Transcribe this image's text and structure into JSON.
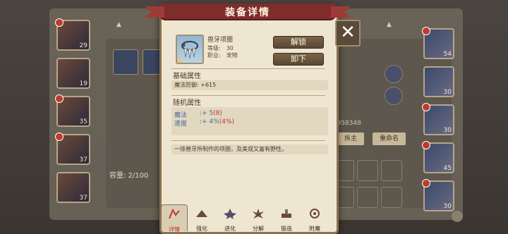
{
  "modal": {
    "title": "装备详情",
    "item_name": "兽牙项圈",
    "level_label": "等级:",
    "level_value": "30",
    "job_label": "职业:",
    "job_value": "宠物",
    "unlock_button": "解锁",
    "unequip_button": "卸下",
    "base_header": "基础属性",
    "base_stat": "魔法防御: +615",
    "random_header": "随机属性",
    "random_stats": [
      {
        "name": "魔法",
        "value": ":+ 5",
        "extra": "(8)"
      },
      {
        "name": "速度",
        "value": ":+ 4%",
        "extra": "(4%)"
      }
    ],
    "description": "一排兽牙所制作的项圈，及美观又富有野性。"
  },
  "tabs": [
    {
      "label": "详情",
      "icon": "detail-icon",
      "active": true
    },
    {
      "label": "强化",
      "icon": "enhance-icon",
      "active": false
    },
    {
      "label": "进化",
      "icon": "evolve-icon",
      "active": false
    },
    {
      "label": "分解",
      "icon": "decompose-icon",
      "active": false
    },
    {
      "label": "锻造",
      "icon": "forge-icon",
      "active": false
    },
    {
      "label": "附魔",
      "icon": "enchant-icon",
      "active": false
    }
  ],
  "background": {
    "capacity_text": "容量: 2/100",
    "left_hero_levels": [
      "29",
      "19",
      "35",
      "37",
      "37"
    ],
    "right_hero_levels": [
      "54",
      "30",
      "30",
      "45",
      "30"
    ],
    "button_left": "拆主",
    "button_right": "重命名",
    "id_text": "ID: 958348"
  },
  "colors": {
    "modal_bg": "#efe6d2",
    "ribbon": "#7e2d2b",
    "button": "#6a5540",
    "stat_blue": "#4a6a9a",
    "stat_red": "#c0392b"
  }
}
